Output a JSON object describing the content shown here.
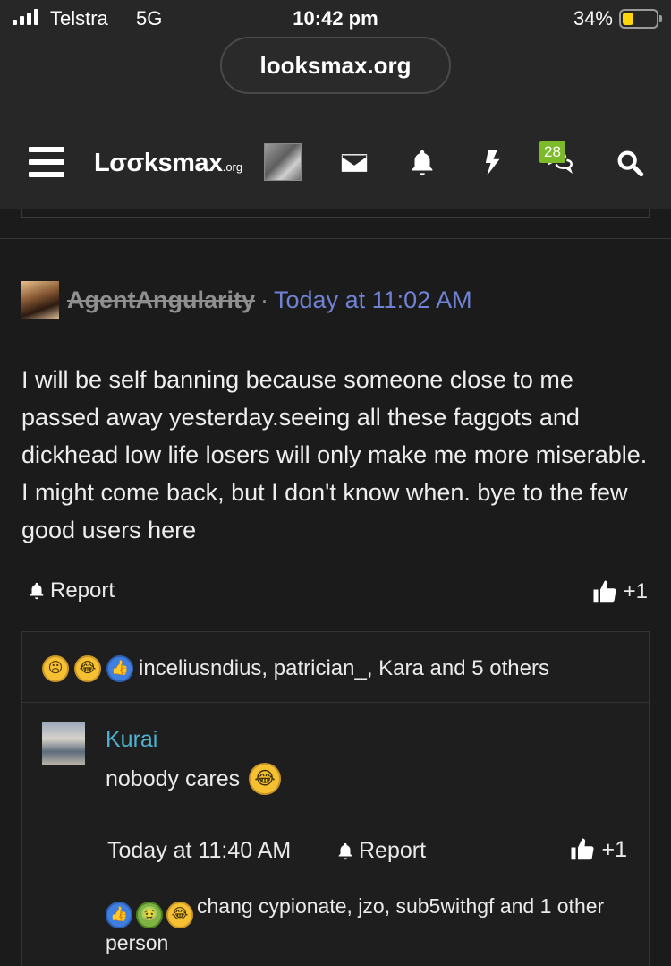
{
  "status_bar": {
    "carrier": "Telstra",
    "network": "5G",
    "time": "10:42 pm",
    "battery_pct": "34%",
    "battery_level": 0.34,
    "battery_color": "#ffd60a"
  },
  "browser": {
    "url": "looksmax.org"
  },
  "nav": {
    "logo": "Lσσksmax",
    "logo_suffix": ".org",
    "icons": [
      "menu-icon",
      "avatar",
      "envelope-icon",
      "bell-icon",
      "bolt-icon",
      "conversations-icon",
      "search-icon"
    ],
    "conversations_badge": "28",
    "badge_color": "#7dba2a"
  },
  "post": {
    "author": "AgentAngularity",
    "separator": "·",
    "time": "Today at 11:02 AM",
    "time_color": "#6f82d4",
    "body": "I will be self banning because someone close to me passed away yesterday.seeing all these faggots and dickhead low life losers will only make me more miserable. I might come back, but I don't know when. bye to the few good users here",
    "report_label": "Report",
    "like_label": "+1",
    "reactions": {
      "emojis": [
        "sad-emoji",
        "crying-laughing-emoji",
        "like-emoji"
      ],
      "text": "inceliusndius, patrician_, Kara and 5 others"
    }
  },
  "comment": {
    "author": "Kurai",
    "author_color": "#4fb0d0",
    "body": "nobody cares",
    "body_emoji": "crying-laughing-emoji",
    "time": "Today at 11:40 AM",
    "report_label": "Report",
    "like_label": "+1",
    "reactions": {
      "emojis": [
        "like-emoji",
        "sick-emoji",
        "crying-laughing-emoji"
      ],
      "text": "chang cypionate, jzo, sub5withgf and 1 other person"
    }
  }
}
